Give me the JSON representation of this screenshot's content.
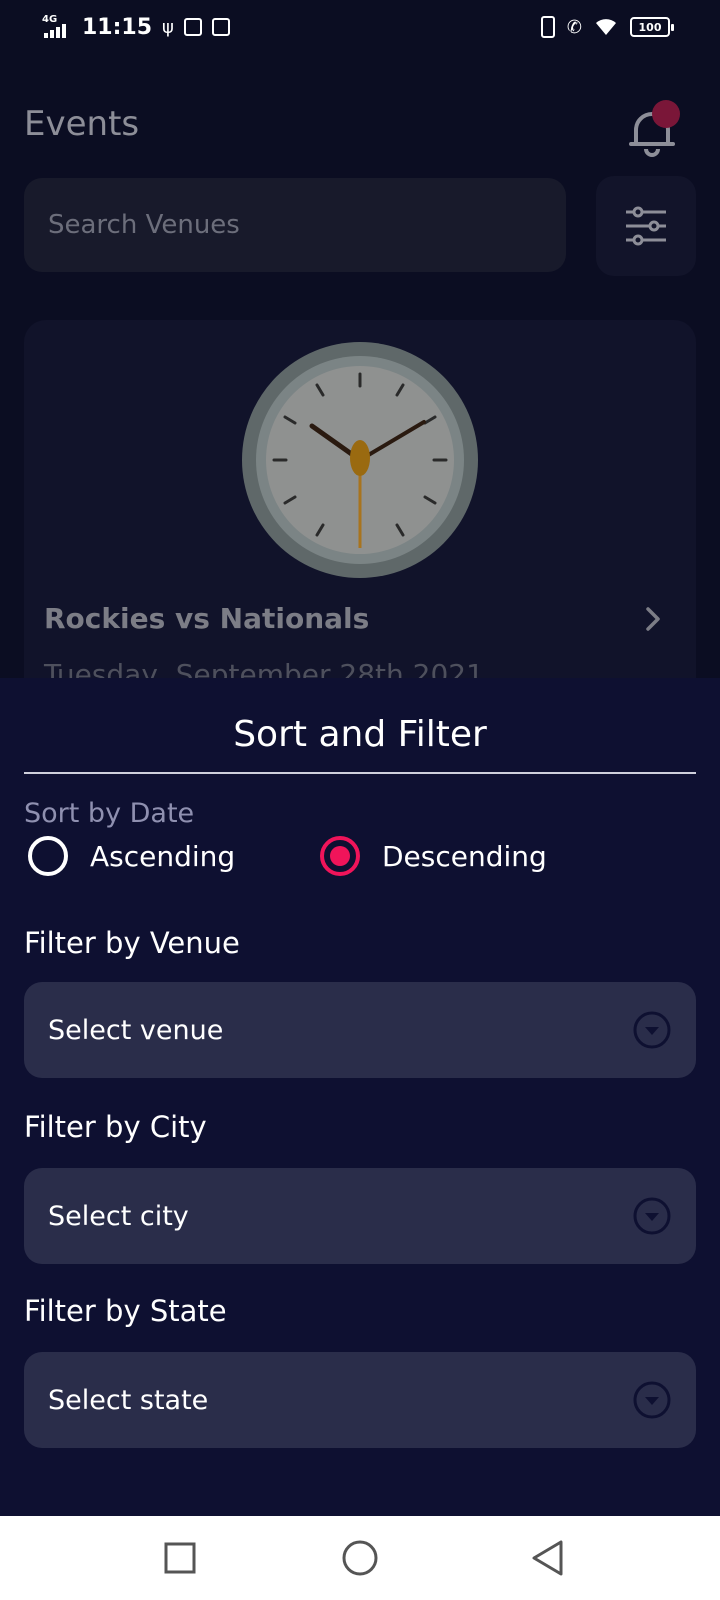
{
  "status_bar": {
    "network": "4G",
    "time": "11:15",
    "battery": "100"
  },
  "header": {
    "title": "Events"
  },
  "search": {
    "placeholder": "Search Venues"
  },
  "event_card": {
    "title": "Rockies vs Nationals",
    "date": "Tuesday, September 28th 2021"
  },
  "sheet": {
    "title": "Sort and Filter",
    "sort_label": "Sort by Date",
    "sort_options": [
      {
        "label": "Ascending",
        "selected": false
      },
      {
        "label": "Descending",
        "selected": true
      }
    ],
    "filters": [
      {
        "label": "Filter by Venue",
        "placeholder": "Select venue"
      },
      {
        "label": "Filter by City",
        "placeholder": "Select city"
      },
      {
        "label": "Filter by State",
        "placeholder": "Select state"
      }
    ]
  },
  "colors": {
    "sheet_background": "#0e1031",
    "accent": "#f0145a",
    "field_background": "#2a2d4a"
  },
  "icons": {
    "bell": "bell-icon",
    "filter": "sliders-icon",
    "chevron_right": "chevron-right-icon",
    "dropdown": "chevron-down-circle-icon",
    "nav": [
      "recents-square-icon",
      "home-circle-icon",
      "back-triangle-icon"
    ]
  }
}
